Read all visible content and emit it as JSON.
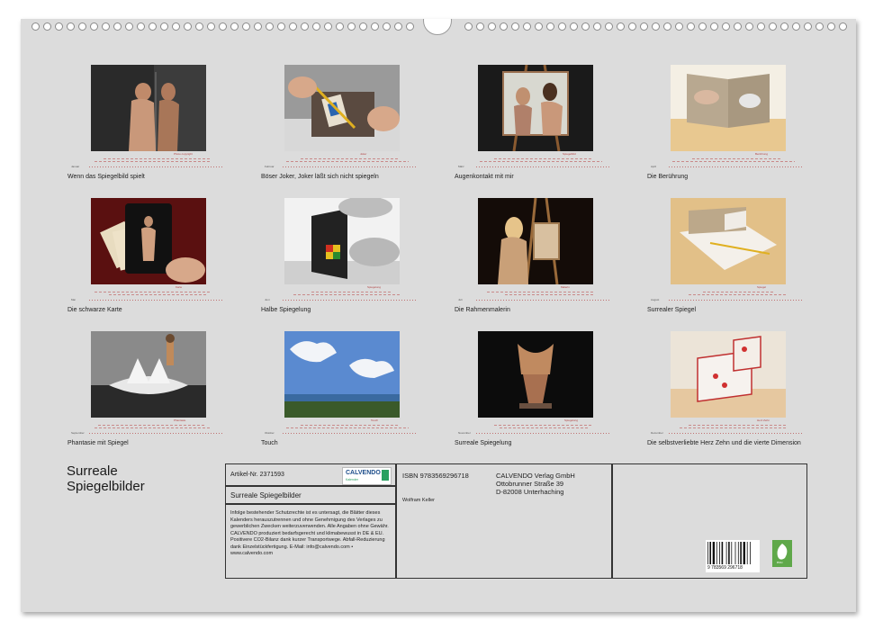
{
  "calendar_title": [
    "Surreale",
    "Spiegelbilder"
  ],
  "months": [
    {
      "caption": "Wenn das Spiegelbild spielt",
      "month": "Januar",
      "credit": "Photo copyright"
    },
    {
      "caption": "Böser Joker, Joker läßt sich nicht spiegeln",
      "month": "Februar",
      "credit": "Joker"
    },
    {
      "caption": "Augenkontakt mit mir",
      "month": "März",
      "credit": "Spiegelbild"
    },
    {
      "caption": "Die Berührung",
      "month": "April",
      "credit": "Berührung"
    },
    {
      "caption": "Die schwarze Karte",
      "month": "Mai",
      "credit": "Karte"
    },
    {
      "caption": "Halbe Spiegelung",
      "month": "Juni",
      "credit": "Spiegelung"
    },
    {
      "caption": "Die Rahmenmalerin",
      "month": "Juli",
      "credit": "Malerin"
    },
    {
      "caption": "Surrealer Spiegel",
      "month": "August",
      "credit": "Spiegel"
    },
    {
      "caption": "Phantasie mit Spiegel",
      "month": "September",
      "credit": "Phantasie"
    },
    {
      "caption": "Touch",
      "month": "Oktober",
      "credit": "Touch"
    },
    {
      "caption": "Surreale Spiegelung",
      "month": "November",
      "credit": "Spiegelung"
    },
    {
      "caption": "Die selbstverliebte Herz Zehn und die vierte Dimension",
      "month": "Dezember",
      "credit": "Herz Zehn"
    }
  ],
  "info": {
    "article": "Artikel-Nr. 2371593",
    "logo": "CALVENDO",
    "logo_sub": "Kalender",
    "title": "Surreale Spiegelbilder",
    "legal": "Infolge bestehender Schutzrechte ist es untersagt, die Blätter dieses Kalenders herauszutrennen und ohne Genehmigung des Verlages zu gewerblichen Zwecken weiterzuverwenden. Alle Angaben ohne Gewähr. CALVENDO produziert bedarfsgerecht und klimabewusst in DE & EU. Positivere CO2-Bilanz dank kurzer Transportwege. Abfall-Reduzierung dank Einzelstückfertigung. E-Mail: info@calvendo.com • www.calvendo.com",
    "isbn": "ISBN 9783569296718",
    "publisher": [
      "CALVENDO Verlag GmbH",
      "Ottobrunner Straße 39",
      "D-82008 Unterhaching"
    ],
    "author": "Wolfram Keller",
    "barcode_text": "9 783569 296718",
    "eco_label": "ecu"
  }
}
